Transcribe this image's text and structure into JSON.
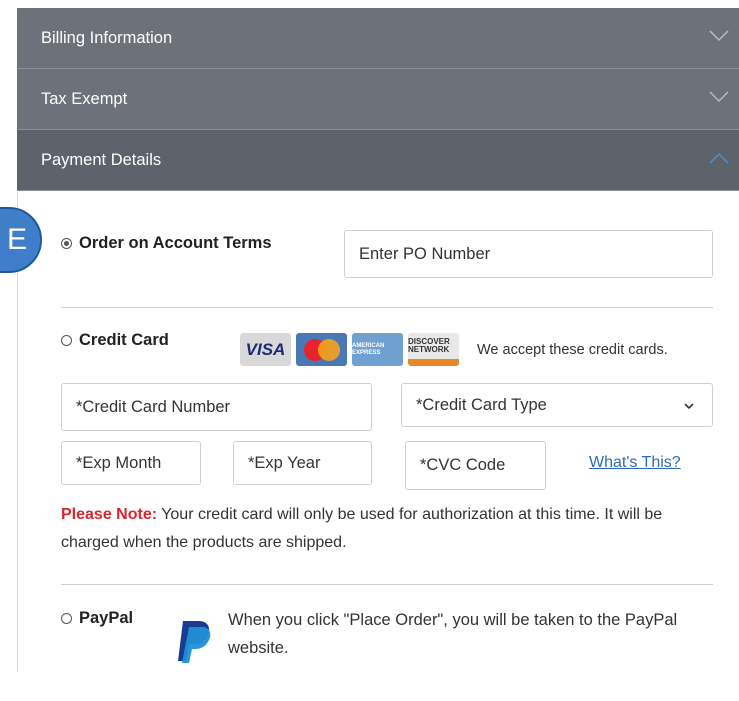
{
  "accordion": {
    "sections": [
      {
        "label": "Billing Information"
      },
      {
        "label": "Tax Exempt"
      },
      {
        "label": "Payment Details"
      }
    ]
  },
  "step_badge": "E",
  "payment": {
    "account_terms": {
      "label": "Order on Account Terms",
      "selected": true,
      "po_placeholder": "Enter PO Number"
    },
    "credit_card": {
      "label": "Credit Card",
      "selected": false,
      "card_brands": [
        "VISA",
        "MasterCard",
        "AMERICAN EXPRESS",
        "DISCOVER NETWORK"
      ],
      "accept_text": "We accept these credit cards.",
      "number_placeholder": "*Credit Card Number",
      "type_selected": "*Credit Card Type",
      "exp_month_placeholder": "*Exp Month",
      "exp_year_placeholder": "*Exp Year",
      "cvc_placeholder": "*CVC Code",
      "whats_this": "What's This?"
    },
    "note": {
      "label": "Please Note:",
      "text": " Your credit card will only be used for authorization at this time. It will be charged when the products are shipped."
    },
    "paypal": {
      "label": "PayPal",
      "selected": false,
      "text": "When you click \"Place Order\", you will be taken to the PayPal website."
    }
  },
  "colors": {
    "header_bg": "#6c717a",
    "header_active_bg": "#5e636b",
    "link": "#2d6bb5",
    "note_label": "#d9262c",
    "badge": "#3f7fc9"
  }
}
